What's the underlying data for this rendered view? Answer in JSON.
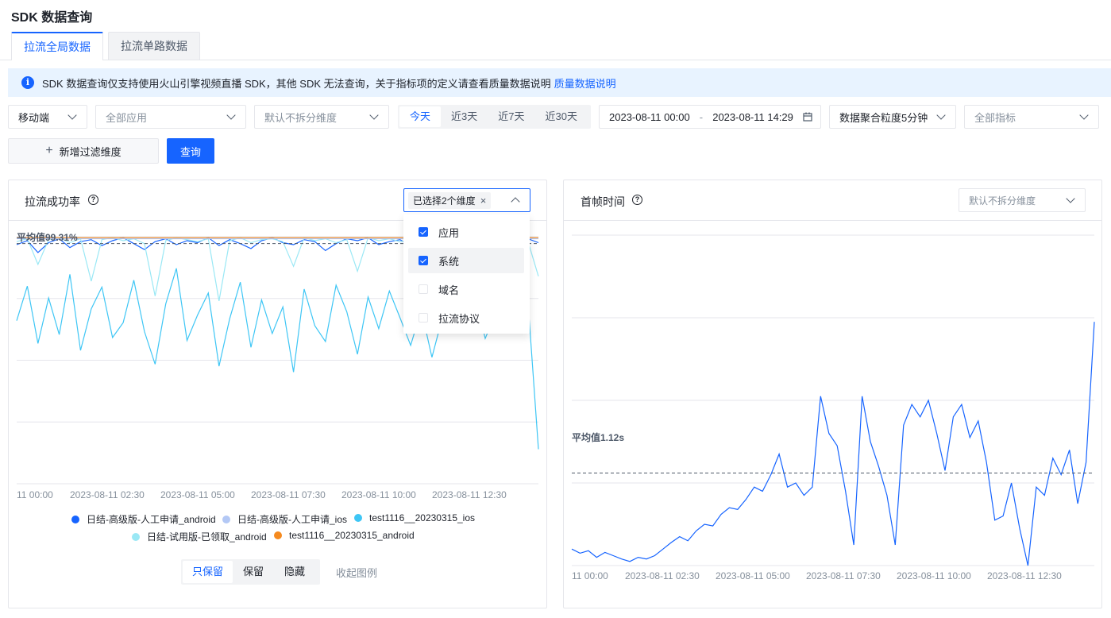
{
  "page_title": "SDK 数据查询",
  "tabs": [
    "拉流全局数据",
    "拉流单路数据"
  ],
  "alert": {
    "text": "SDK 数据查询仅支持使用火山引擎视频直播 SDK，其他 SDK 无法查询，关于指标项的定义请查看质量数据说明",
    "link": "质量数据说明"
  },
  "filters": {
    "platform": "移动端",
    "app_placeholder": "全部应用",
    "dimension_placeholder": "默认不拆分维度",
    "time_ranges": [
      "今天",
      "近3天",
      "近7天",
      "近30天"
    ],
    "date_start": "2023-08-11 00:00",
    "date_sep": "-",
    "date_end": "2023-08-11 14:29",
    "granularity": "数据聚合粒度5分钟",
    "metric_placeholder": "全部指标"
  },
  "buttons": {
    "add_filter": "新增过滤维度",
    "query": "查询"
  },
  "left_panel": {
    "title": "拉流成功率",
    "dimension_tag": "已选择2个维度",
    "dropdown_options": [
      {
        "label": "应用",
        "checked": true
      },
      {
        "label": "系统",
        "checked": true
      },
      {
        "label": "域名",
        "checked": false
      },
      {
        "label": "拉流协议",
        "checked": false
      }
    ],
    "avg_label": "平均值99.31%",
    "x_ticks": [
      "11 00:00",
      "2023-08-11 02:30",
      "2023-08-11 05:00",
      "2023-08-11 07:30",
      "2023-08-11 10:00",
      "2023-08-11 12:30"
    ],
    "legend": [
      {
        "name": "日结-高级版-人工申请_android",
        "color": "#1664ff"
      },
      {
        "name": "日结-高级版-人工申请_ios",
        "color": "#b3c8f5"
      },
      {
        "name": "test1116__20230315_ios",
        "color": "#3ec6f5"
      },
      {
        "name": "日结-试用版-已领取_android",
        "color": "#9ae8f5"
      },
      {
        "name": "test1116__20230315_android",
        "color": "#f58a1f"
      }
    ],
    "legend_controls": [
      "只保留",
      "保留",
      "隐藏"
    ],
    "collapse_legend": "收起图例"
  },
  "right_panel": {
    "title": "首帧时间",
    "dimension_placeholder": "默认不拆分维度",
    "avg_label": "平均值1.12s",
    "x_ticks": [
      "11 00:00",
      "2023-08-11 02:30",
      "2023-08-11 05:00",
      "2023-08-11 07:30",
      "2023-08-11 10:00",
      "2023-08-11 12:30"
    ]
  },
  "chart_data": [
    {
      "type": "line",
      "title": "拉流成功率",
      "x_ticks": [
        "11 00:00",
        "2023-08-11 02:30",
        "2023-08-11 05:00",
        "2023-08-11 07:30",
        "2023-08-11 10:00",
        "2023-08-11 12:30"
      ],
      "ylim": [
        75,
        100
      ],
      "average": 99.31,
      "series": [
        {
          "name": "日结-高级版-人工申请_android",
          "color": "#1664ff",
          "values": [
            99.2,
            99.6,
            98.4,
            99.4,
            99.8,
            98.9,
            99.5,
            99.7,
            99.1,
            99.6,
            99.9,
            99.3,
            98.7,
            99.5,
            99.8,
            99.2,
            99.6,
            99.4,
            99.9,
            99.1,
            99.7,
            99.3,
            98.8,
            99.6,
            99.9,
            99.4,
            99.2,
            99.7,
            99.5,
            98.6,
            99.3,
            99.8,
            99.6,
            99.9,
            99.2,
            99.5,
            99.7,
            99.1,
            99.6,
            99.8,
            99.4,
            99.9,
            99.3,
            99.5,
            96.0,
            97.8,
            99.6,
            99.2,
            99.8,
            99.4
          ]
        },
        {
          "name": "日结-试用版-已领取_android",
          "color": "#9ae8f5",
          "values": [
            99.5,
            99.8,
            97.2,
            99.7,
            99.9,
            99.4,
            99.8,
            95.5,
            99.7,
            99.9,
            99.6,
            99.8,
            99.3,
            94.0,
            99.6,
            99.9,
            99.7,
            99.5,
            99.8,
            93.5,
            99.6,
            99.9,
            99.4,
            99.7,
            99.8,
            99.5,
            97.0,
            99.9,
            99.6,
            99.8,
            99.4,
            99.7,
            96.5,
            99.9,
            99.6,
            99.8,
            99.5,
            99.7,
            99.9,
            99.4,
            95.0,
            99.6,
            99.8,
            99.5,
            96.5,
            99.7,
            99.9,
            99.4,
            99.6,
            96.0
          ]
        },
        {
          "name": "test1116__20230315_ios",
          "color": "#3ec6f5",
          "values": [
            91.5,
            95.0,
            89.2,
            93.8,
            90.1,
            96.2,
            88.5,
            92.7,
            94.9,
            89.8,
            91.3,
            95.6,
            90.4,
            87.1,
            93.2,
            96.8,
            89.5,
            92.1,
            94.3,
            86.9,
            91.7,
            95.4,
            88.8,
            93.6,
            90.2,
            92.9,
            86.3,
            94.7,
            91.0,
            89.4,
            95.1,
            92.4,
            88.1,
            93.9,
            90.7,
            94.5,
            91.8,
            89.0,
            92.6,
            87.8,
            91.9,
            93.4,
            90.5,
            94.2,
            89.7,
            92.3,
            95.3,
            91.1,
            93.7,
            78.5
          ]
        },
        {
          "name": "日结-高级版-人工申请_ios",
          "color": "#b3c8f5",
          "values": [
            99.8,
            99.8,
            99.8,
            99.8,
            99.8,
            99.8,
            99.8,
            99.8,
            99.8,
            99.8,
            99.8,
            99.8,
            99.8,
            99.8,
            99.8,
            99.8,
            99.8,
            99.8,
            99.8,
            99.8,
            99.8,
            99.8,
            99.8,
            99.8,
            99.8,
            99.8,
            99.8,
            99.8,
            99.8,
            99.8,
            99.8,
            99.8,
            99.8,
            99.8,
            99.8,
            99.8,
            99.8,
            99.8,
            99.8,
            99.8,
            99.8,
            99.8,
            99.8,
            99.8,
            99.8,
            99.8,
            99.8,
            99.8,
            99.8,
            99.8
          ]
        },
        {
          "name": "test1116__20230315_android",
          "color": "#f58a1f",
          "values": [
            99.9,
            99.9,
            99.9,
            99.9,
            99.9,
            99.9,
            99.9,
            99.9,
            99.9,
            99.9,
            99.9,
            99.9,
            99.9,
            99.9,
            99.9,
            99.9,
            99.9,
            99.9,
            99.9,
            99.9,
            99.9,
            99.9,
            99.9,
            99.9,
            99.9,
            99.9,
            99.9,
            99.9,
            99.9,
            99.9,
            99.9,
            99.9,
            99.9,
            99.9,
            99.9,
            99.9,
            99.9,
            99.9,
            99.9,
            99.9,
            99.9,
            99.9,
            99.9,
            99.9,
            99.9,
            99.9,
            99.9,
            99.9,
            99.9,
            99.9
          ]
        }
      ]
    },
    {
      "type": "line",
      "title": "首帧时间",
      "x_ticks": [
        "11 00:00",
        "2023-08-11 02:30",
        "2023-08-11 05:00",
        "2023-08-11 07:30",
        "2023-08-11 10:00",
        "2023-08-11 12:30"
      ],
      "ylim": [
        0,
        4
      ],
      "average": 1.12,
      "series": [
        {
          "values": [
            0.2,
            0.15,
            0.18,
            0.1,
            0.16,
            0.12,
            0.08,
            0.05,
            0.1,
            0.08,
            0.12,
            0.2,
            0.28,
            0.35,
            0.3,
            0.42,
            0.5,
            0.48,
            0.62,
            0.7,
            0.68,
            0.8,
            0.95,
            0.9,
            1.1,
            1.35,
            0.95,
            1.0,
            0.85,
            0.95,
            2.05,
            1.6,
            1.45,
            0.9,
            0.25,
            2.05,
            1.5,
            1.2,
            0.85,
            0.25,
            1.7,
            1.95,
            1.8,
            2.0,
            1.6,
            1.15,
            1.8,
            1.95,
            1.55,
            1.75,
            1.25,
            0.55,
            0.6,
            1.0,
            0.45,
            0.0,
            0.95,
            0.85,
            1.3,
            1.1,
            1.4,
            0.75,
            1.25,
            2.95
          ]
        }
      ]
    }
  ]
}
